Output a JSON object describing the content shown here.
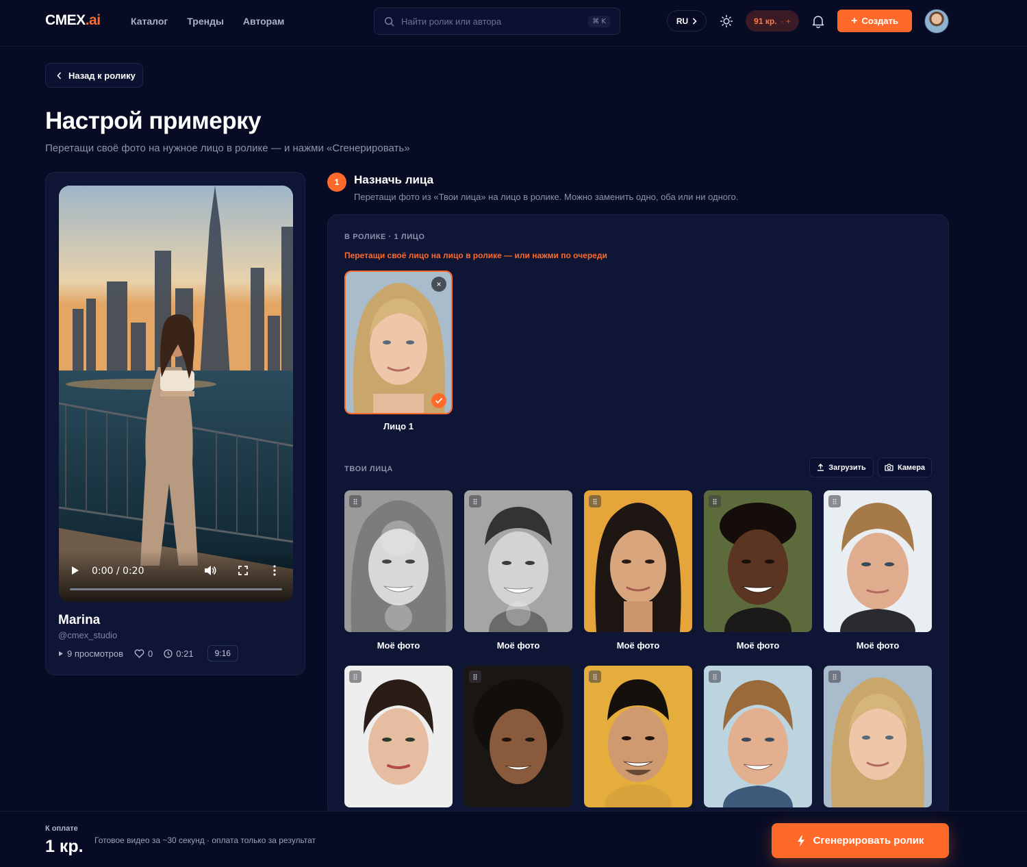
{
  "header": {
    "logo_main": "CMEX",
    "logo_dot": ".ai",
    "nav": [
      "Каталог",
      "Тренды",
      "Авторам"
    ],
    "search_placeholder": "Найти ролик или автора",
    "search_shortcut": "⌘ K",
    "language": "RU",
    "credits": "91 кр.",
    "credits_plus": "· +",
    "create_label": "Создать"
  },
  "back_label": "Назад к ролику",
  "page": {
    "title": "Настрой примерку",
    "subtitle": "Перетащи своё фото на нужное лицо в ролике — и нажми «Сгенерировать»"
  },
  "video": {
    "time": "0:00 / 0:20",
    "progress": 0,
    "author_name": "Marina",
    "author_handle": "@cmex_studio",
    "views": "9 просмотров",
    "likes": "0",
    "duration": "0:21",
    "ratio": "9:16"
  },
  "step": {
    "number": "1",
    "title": "Назначь лица",
    "description": "Перетащи фото из «Твои лица» на лицо в ролике. Можно заменить одно, оба или ни одного."
  },
  "in_video": {
    "label": "В РОЛИКЕ · 1 ЛИЦО",
    "hint": "Перетащи своё лицо на лицо в ролике — или нажми по очереди",
    "slot_label": "Лицо 1",
    "remove_icon": "×"
  },
  "your_faces": {
    "label": "ТВОИ ЛИЦА",
    "upload_label": "Загрузить",
    "camera_label": "Камера",
    "tiles": [
      {
        "label": "Моё фото"
      },
      {
        "label": "Моё фото"
      },
      {
        "label": "Моё фото"
      },
      {
        "label": "Моё фото"
      },
      {
        "label": "Моё фото"
      },
      {
        "label": ""
      },
      {
        "label": ""
      },
      {
        "label": ""
      },
      {
        "label": ""
      },
      {
        "label": ""
      }
    ]
  },
  "footer": {
    "pay_label": "К оплате",
    "amount": "1 кр.",
    "note": "Готовое видео за ~30 секунд · оплата только за результат",
    "generate_label": "Сгенерировать ролик"
  },
  "colors": {
    "accent": "#ff6a2b",
    "background": "#070c24",
    "panel": "#0e1535"
  }
}
